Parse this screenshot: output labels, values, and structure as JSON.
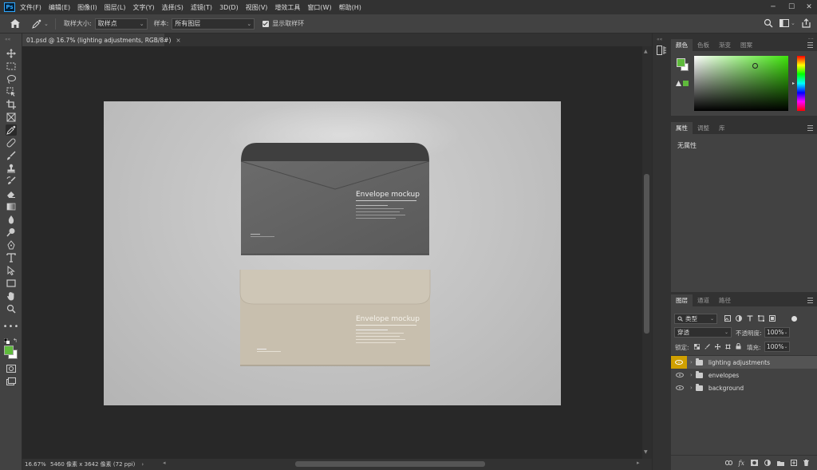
{
  "app": {
    "logo_text": "Ps"
  },
  "menu": [
    "文件(F)",
    "编辑(E)",
    "图像(I)",
    "图层(L)",
    "文字(Y)",
    "选择(S)",
    "滤镜(T)",
    "3D(D)",
    "视图(V)",
    "增效工具",
    "窗口(W)",
    "帮助(H)"
  ],
  "window_controls": {
    "minimize": "─",
    "maximize": "☐",
    "close": "✕"
  },
  "options": {
    "sample_size_label": "取样大小:",
    "sample_size_value": "取样点",
    "sample_label": "样本:",
    "sample_value": "所有图层",
    "show_ring_label": "显示取样环"
  },
  "document": {
    "tab_title": "01.psd @ 16.7% (lighting adjustments, RGB/8#)",
    "tab_close": "×"
  },
  "mockup": {
    "top_title": "Envelope mockup",
    "bottom_title": "Envelope mockup"
  },
  "status": {
    "zoom": "16.67%",
    "doc_info": "5460 像素 x 3642 像素 (72 ppi)",
    "arrow": "›"
  },
  "color_panel": {
    "tabs": [
      "颜色",
      "色板",
      "渐变",
      "图案"
    ],
    "foreground": "#5fba3c",
    "background": "#ffffff"
  },
  "properties_panel": {
    "tabs": [
      "属性",
      "调整",
      "库"
    ],
    "content": "无属性"
  },
  "layers_panel": {
    "tabs": [
      "图层",
      "通道",
      "路径"
    ],
    "filter_label": "类型",
    "blend_mode": "穿透",
    "opacity_label": "不透明度:",
    "opacity_value": "100%",
    "lock_label": "锁定:",
    "fill_label": "填充:",
    "fill_value": "100%",
    "layers": [
      {
        "name": "lighting adjustments",
        "selected": true
      },
      {
        "name": "envelopes",
        "selected": false
      },
      {
        "name": "background",
        "selected": false
      }
    ],
    "footer_icons": [
      "link-icon",
      "fx-icon",
      "mask-icon",
      "adjustment-icon",
      "group-icon",
      "new-layer-icon",
      "trash-icon"
    ],
    "fx_label": "fx"
  }
}
